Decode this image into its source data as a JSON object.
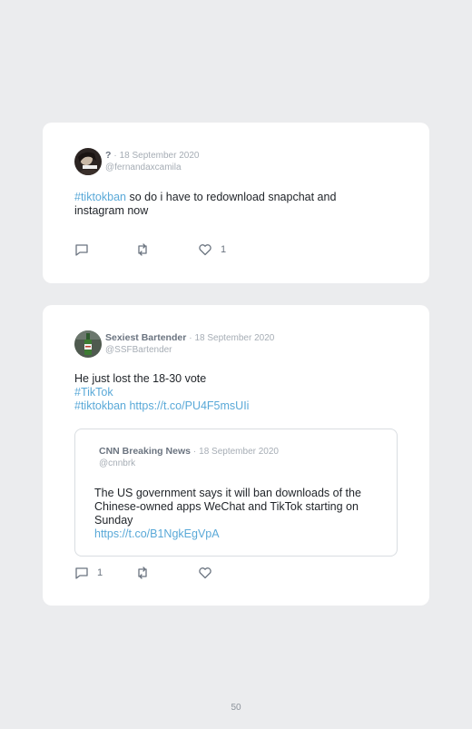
{
  "tweets": [
    {
      "author_name": "?",
      "date": "18 September 2020",
      "handle": "@fernandaxcamila",
      "text_hashtag": "#tiktokban",
      "text_rest": " so do i have to redownload snapchat and instagram now",
      "reply_count": "",
      "retweet_count": "",
      "like_count": "1"
    },
    {
      "author_name": "Sexiest Bartender",
      "date": "18 September 2020",
      "handle": "@SSFBartender",
      "text_line1": "He just lost the 18-30 vote",
      "text_hashtag1": "#TikTok",
      "text_hashtag2": "#tiktokban",
      "text_link": "https://t.co/PU4F5msUIi",
      "reply_count": "1",
      "retweet_count": "",
      "like_count": "",
      "quoted": {
        "author_name": "CNN Breaking News",
        "date": "18 September 2020",
        "handle": "@cnnbrk",
        "text": "The US government says it will ban downloads of the Chinese-owned apps WeChat and TikTok starting on Sunday",
        "link": "https://t.co/B1NgkEgVpA"
      }
    }
  ],
  "separator": "·",
  "page_number": "50",
  "colors": {
    "link": "#5aa9d8",
    "background": "#ebecee",
    "card": "#ffffff"
  },
  "icons": [
    "reply-icon",
    "retweet-icon",
    "like-icon"
  ]
}
